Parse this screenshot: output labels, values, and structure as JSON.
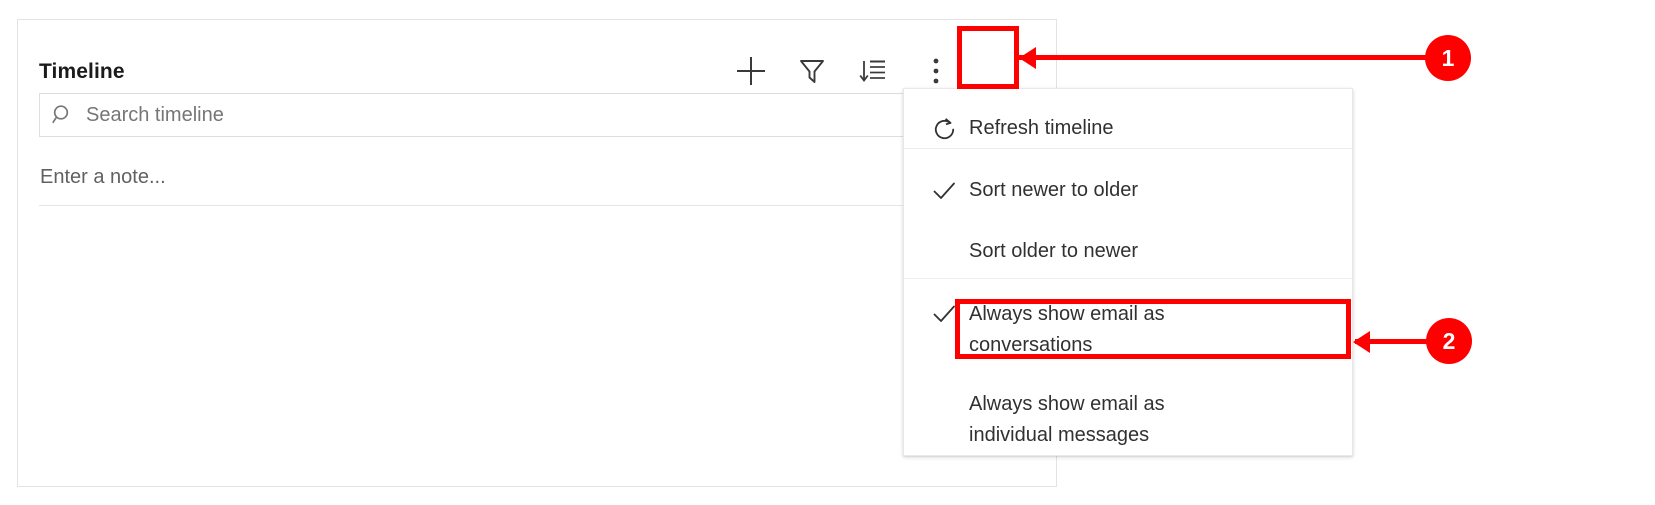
{
  "panel": {
    "title": "Timeline",
    "toolbar": [
      {
        "name": "add-icon",
        "label": "Add"
      },
      {
        "name": "filter-icon",
        "label": "Filter"
      },
      {
        "name": "sort-icon",
        "label": "Sort"
      },
      {
        "name": "more-options-icon",
        "label": "More commands"
      }
    ],
    "search": {
      "icon": "search-icon",
      "placeholder": "Search timeline",
      "value": ""
    },
    "note": {
      "placeholder": "Enter a note...",
      "value": ""
    }
  },
  "menu": {
    "items": [
      {
        "id": "refresh",
        "label": "Refresh timeline",
        "icon": "refresh-icon",
        "checked": false
      },
      {
        "id": "sort_new",
        "label": "Sort newer to older",
        "icon": "check-icon",
        "checked": true
      },
      {
        "id": "sort_old",
        "label": "Sort older to newer",
        "icon": "",
        "checked": false
      },
      {
        "id": "conv",
        "label": "Always show email as\nconversations",
        "icon": "check-icon",
        "checked": true
      },
      {
        "id": "individual",
        "label": "Always show email as\nindividual messages",
        "icon": "",
        "checked": false
      }
    ]
  },
  "annotations": {
    "accent_color": "#ff0000",
    "callouts": [
      {
        "number": "1",
        "target": "more-options-icon"
      },
      {
        "number": "2",
        "target": "always-show-email-as-conversations"
      }
    ]
  }
}
